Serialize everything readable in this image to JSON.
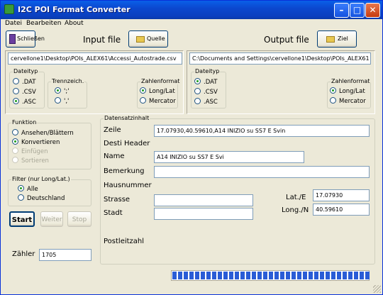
{
  "window": {
    "title": "I2C POI Format Converter"
  },
  "menu": [
    "Datei",
    "Bearbeiten",
    "About"
  ],
  "toolbar": {
    "schliessen_label": "Schließen",
    "input_file_label": "Input file",
    "quelle_label": "Quelle",
    "output_file_label": "Output file",
    "ziel_label": "Ziel"
  },
  "input": {
    "path": "cervellone1\\Desktop\\POIs_ALEX61\\Accessi_Autostrade.csv",
    "dateityp": {
      "caption": "Dateityp",
      "options": [
        ".DAT",
        ".CSV",
        ".ASC"
      ],
      "selected": ".ASC"
    },
    "trennzeichen": {
      "caption": "Trennzeich.",
      "options": [
        "';'",
        "','"
      ],
      "selected": "';'"
    },
    "zahlenformat": {
      "caption": "Zahlenformat",
      "options": [
        "Long/Lat",
        "Mercator"
      ],
      "selected": "Long/Lat"
    }
  },
  "output": {
    "path": "C:\\Documents and Settings\\cervellone1\\Desktop\\POIs_ALEX61",
    "dateityp": {
      "caption": "Dateityp",
      "options": [
        ".DAT",
        ".CSV",
        ".ASC"
      ],
      "selected": ".DAT"
    },
    "zahlenformat": {
      "caption": "Zahlenformat",
      "options": [
        "Long/Lat",
        "Mercator"
      ],
      "selected": "Long/Lat"
    }
  },
  "funktion": {
    "caption": "Funktion",
    "options": [
      "Ansehen/Blättern",
      "Konvertieren",
      "Einfügen",
      "Sortieren"
    ],
    "selected": "Konvertieren",
    "disabled": [
      "Einfügen",
      "Sortieren"
    ]
  },
  "filter": {
    "caption": "Filter (nur Long/Lat.)",
    "options": [
      "Alle",
      "Deutschland"
    ],
    "selected": "Alle"
  },
  "actions": {
    "start": "Start",
    "weiter": "Weiter",
    "stop": "Stop"
  },
  "zaehler": {
    "label": "Zähler",
    "value": "1705"
  },
  "datensatz": {
    "caption": "Datensatzinhalt",
    "zeile_label": "Zeile",
    "zeile_value": "17.07930,40.59610,A14 INIZIO su SS7 E Svin",
    "desti_header": "Desti Header",
    "name_label": "Name",
    "name_value": "A14 INIZIO su SS7 E Svi",
    "bemerkung_label": "Bemerkung",
    "bemerkung_value": "",
    "hausnummer_label": "Hausnummer",
    "strasse_label": "Strasse",
    "strasse_value": "",
    "stadt_label": "Stadt",
    "stadt_value": "",
    "postleitzahl_label": "Postleitzahl",
    "lat_label": "Lat./E",
    "lat_value": "17.07930",
    "long_label": "Long./N",
    "long_value": "40.59610"
  },
  "progress": {
    "fraction": 1.0
  },
  "colors": {
    "titlebar": "#0a48cf",
    "progress": "#2a5cd6",
    "face": "#ece9d8"
  }
}
